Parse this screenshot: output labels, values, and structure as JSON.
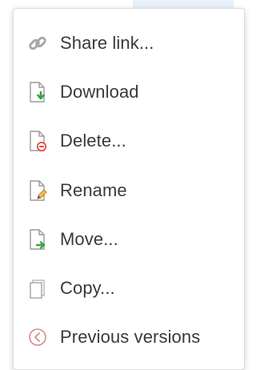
{
  "colors": {
    "text": "#3a3a3a",
    "icon_outline": "#9a9a9a",
    "download_green": "#3aa24a",
    "delete_red": "#d9534f",
    "rename_orange": "#e0a030",
    "move_green": "#3aa24a"
  },
  "menu": {
    "items": [
      {
        "label": "Share link...",
        "icon": "link-icon"
      },
      {
        "label": "Download",
        "icon": "download-icon"
      },
      {
        "label": "Delete...",
        "icon": "delete-icon"
      },
      {
        "label": "Rename",
        "icon": "rename-icon"
      },
      {
        "label": "Move...",
        "icon": "move-icon"
      },
      {
        "label": "Copy...",
        "icon": "copy-icon"
      },
      {
        "label": "Previous versions",
        "icon": "history-icon"
      }
    ]
  }
}
